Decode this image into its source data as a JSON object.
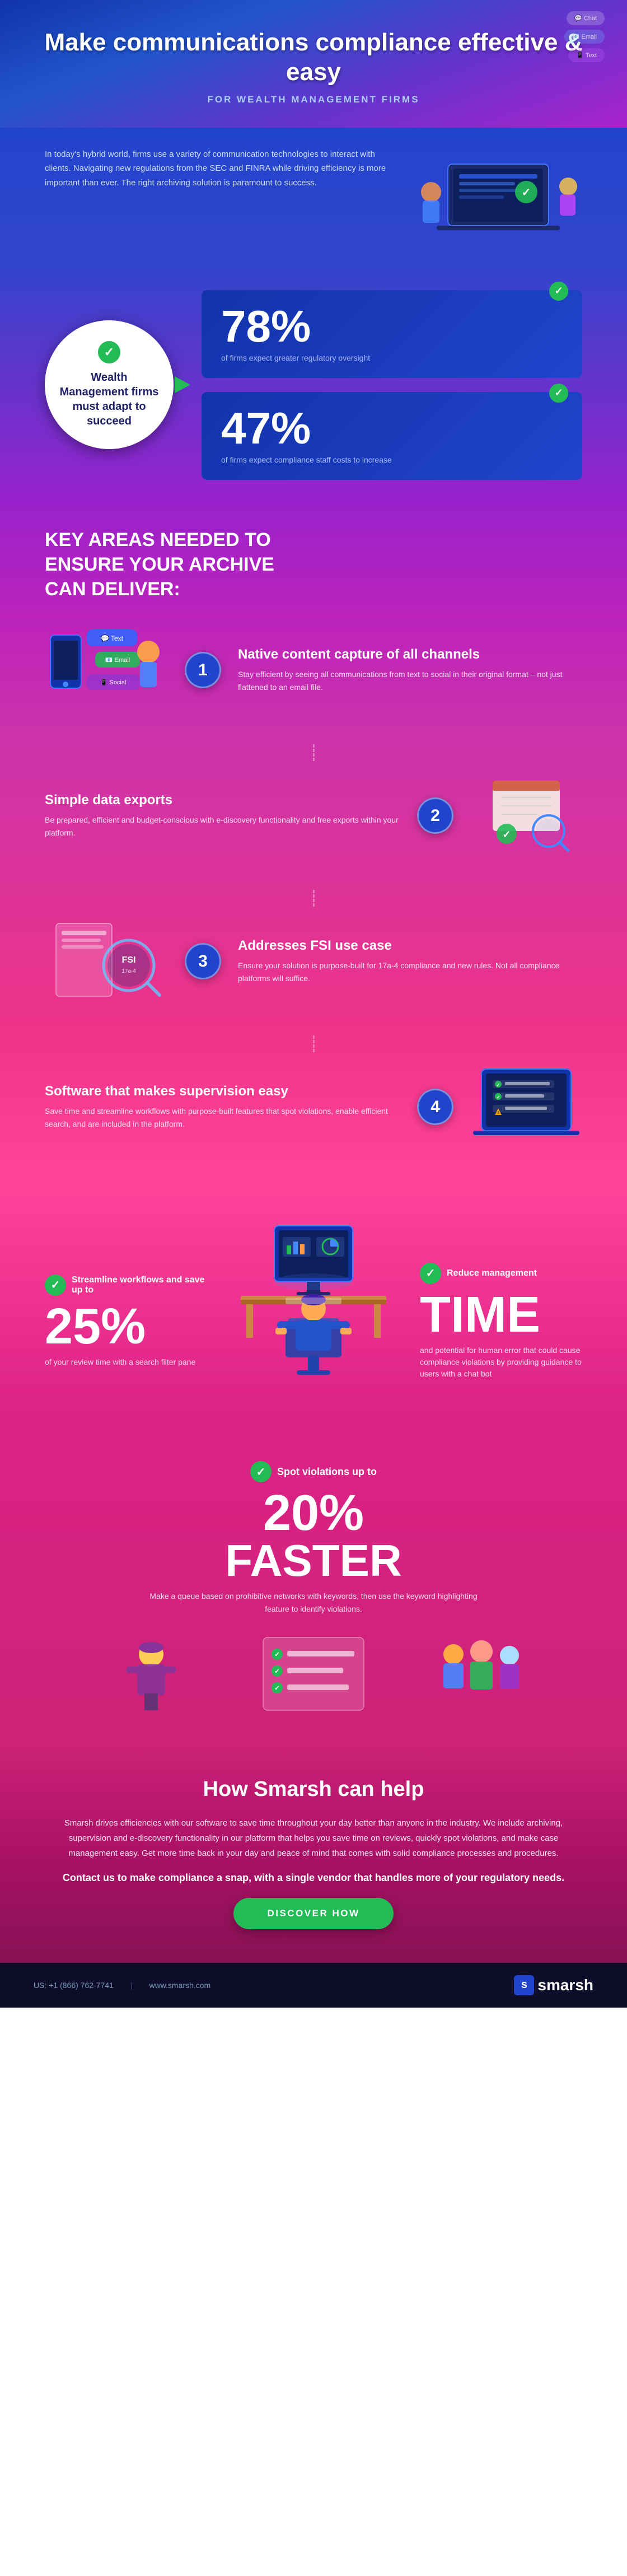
{
  "header": {
    "title": "Make communications compliance effective & easy",
    "subtitle": "FOR WEALTH MANAGEMENT FIRMS"
  },
  "intro": {
    "body": "In today's hybrid world, firms use a variety of communication technologies to interact with clients. Navigating new regulations from the SEC and FINRA while driving efficiency is more important than ever. The right archiving solution is paramount to success."
  },
  "wealth_circle": {
    "check_icon": "✓",
    "text": "Wealth Management firms must adapt to succeed"
  },
  "stats": [
    {
      "percent": "78%",
      "description": "of firms expect greater regulatory oversight"
    },
    {
      "percent": "47%",
      "description": "of firms expect compliance staff costs to increase"
    }
  ],
  "key_areas": {
    "title": "KEY AREAS NEEDED TO ENSURE YOUR ARCHIVE CAN DELIVER:",
    "items": [
      {
        "number": "1",
        "heading": "Native content capture of all channels",
        "description": "Stay efficient by seeing all communications from text to social in their original format – not just flattened to an email file."
      },
      {
        "number": "2",
        "heading": "Simple data exports",
        "description": "Be prepared, efficient and budget-conscious with e-discovery functionality and free exports within your platform."
      },
      {
        "number": "3",
        "heading": "Addresses FSI use case",
        "description": "Ensure your solution is purpose-built for 17a-4 compliance and new rules. Not all compliance platforms will suffice."
      },
      {
        "number": "4",
        "heading": "Software that makes supervision easy",
        "description": "Save time and streamline workflows with purpose-built features that spot violations, enable efficient search, and are included in the platform."
      }
    ]
  },
  "features": {
    "streamline": {
      "check": "✓",
      "label": "Streamline workflows and save up to",
      "percent": "25%",
      "detail": "of your review time with a search filter pane"
    },
    "time": {
      "check": "✓",
      "label": "Reduce management",
      "big_word": "TIME",
      "detail": "and potential for human error that could cause compliance violations by providing guidance to users with a chat bot"
    },
    "spot": {
      "check": "✓",
      "label": "Spot violations up to",
      "percent": "20%",
      "big_word": "FASTER",
      "detail": "Make a queue based on prohibitive networks with keywords, then use the keyword highlighting feature to identify violations."
    }
  },
  "smarsh_help": {
    "heading": "How Smarsh can help",
    "body1": "Smarsh drives efficiencies with our software to save time throughout your day better than anyone in the industry. We include archiving, supervision and e-discovery functionality in our platform that helps you save time on reviews, quickly spot violations, and make case management easy. Get more time back in your day and peace of mind that comes with solid compliance processes and procedures.",
    "cta_text": "Contact us to make compliance a snap, with a single vendor that handles more of your regulatory needs.",
    "button_label": "DISCOVER HOW"
  },
  "footer": {
    "phone": "US: +1 (866) 762-7741",
    "website": "www.smarsh.com",
    "logo": "smarsh"
  },
  "colors": {
    "green": "#22bb55",
    "blue_dark": "#1a1a8c",
    "blue_mid": "#2244cc",
    "purple": "#7722bb",
    "pink": "#cc33aa",
    "magenta": "#ee2288",
    "dark_bg": "#1a1a3a"
  }
}
